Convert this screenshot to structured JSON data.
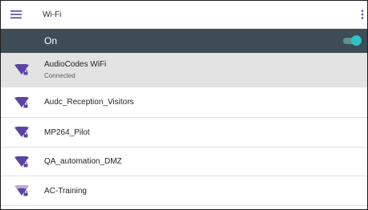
{
  "header": {
    "title": "Wi-Fi"
  },
  "wifi_toggle": {
    "label": "On",
    "state": "on"
  },
  "networks": [
    {
      "name": "AudioCodes WiFi",
      "status": "Connected",
      "selected": true,
      "icon": "wifi-secure-full-icon"
    },
    {
      "name": "Audc_Reception_Visitors",
      "status": "",
      "icon": "wifi-secure-full-icon"
    },
    {
      "name": "MP264_Pilot",
      "status": "",
      "icon": "wifi-secure-full-icon"
    },
    {
      "name": "QA_automation_DMZ",
      "status": "",
      "icon": "wifi-secure-full-icon"
    },
    {
      "name": "AC-Training",
      "status": "",
      "icon": "wifi-secure-partial-icon"
    }
  ],
  "colors": {
    "accent": "#2fc1c4",
    "toolbar": "#3d4c55",
    "wifi_icon": "#5b43a6"
  }
}
